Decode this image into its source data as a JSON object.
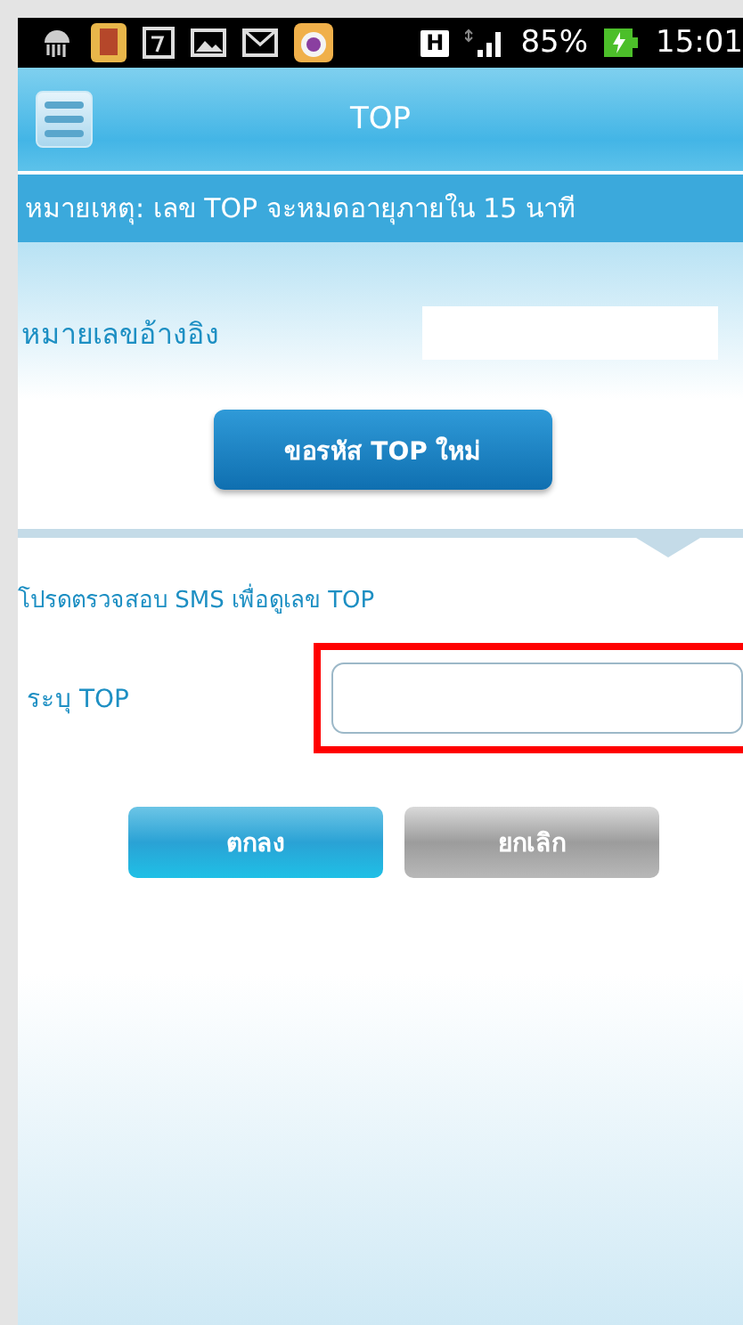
{
  "status_bar": {
    "network_type": "H",
    "battery": "85%",
    "time": "15:01"
  },
  "app_bar": {
    "title": "TOP"
  },
  "notice": "หมายเหตุ: เลข TOP จะหมดอายุภายใน 15 นาที",
  "reference": {
    "label": "หมายเลขอ้างอิง"
  },
  "request_button": "ขอรหัส TOP ใหม่",
  "instruction": "โปรดตรวจสอบ SMS เพื่อดูเลข TOP",
  "top_field": {
    "label": "ระบุ TOP",
    "highlighted": true
  },
  "buttons": [
    {
      "label": "ตกลง",
      "kind": "primary"
    },
    {
      "label": "ยกเลิก",
      "kind": "secondary"
    }
  ]
}
